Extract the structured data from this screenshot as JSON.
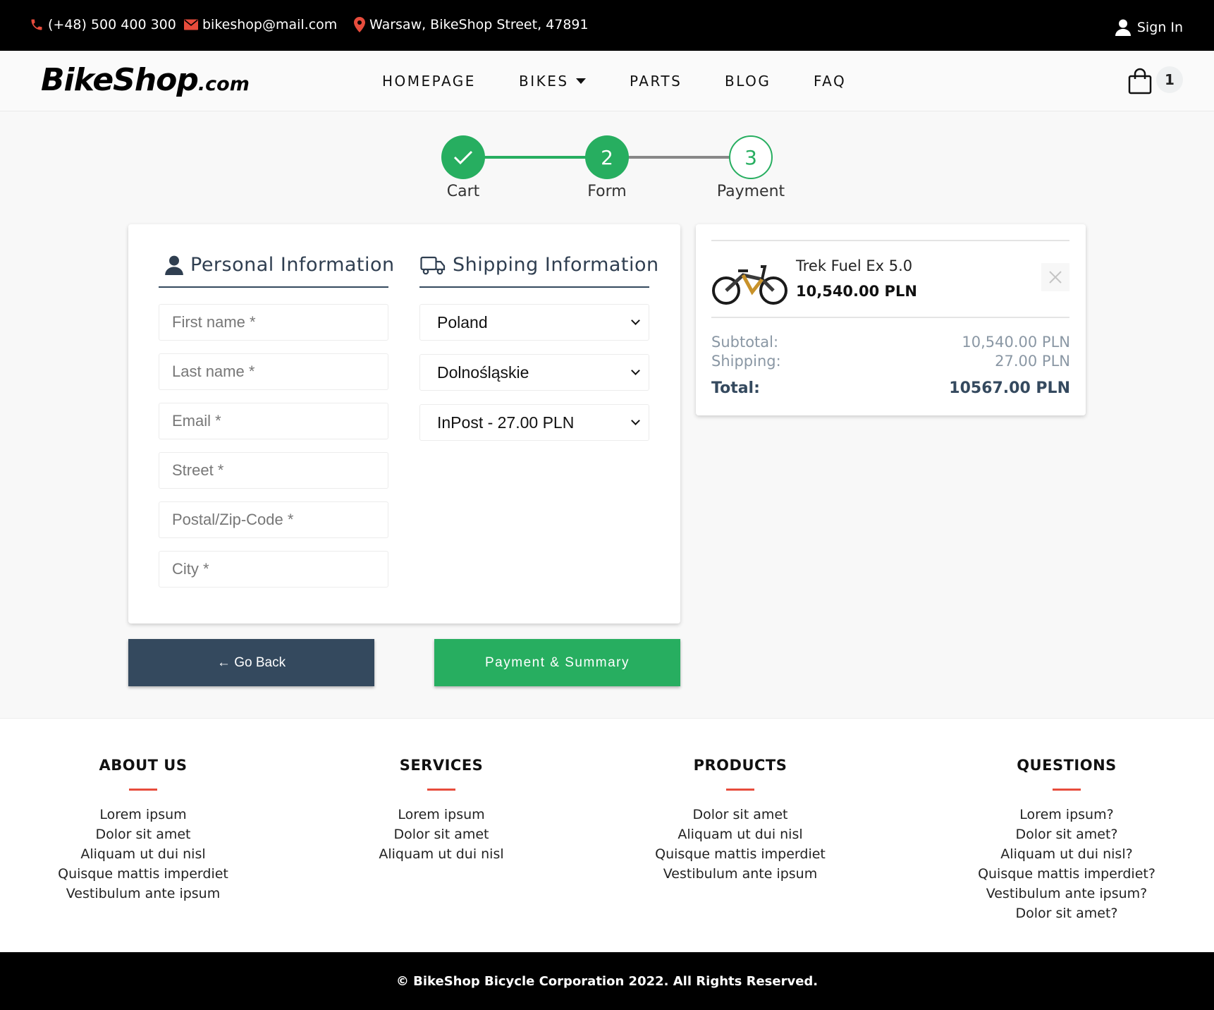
{
  "topbar": {
    "phone": "(+48) 500 400 300",
    "email": "bikeshop@mail.com",
    "address": "Warsaw, BikeShop Street, 47891",
    "sign_in": "Sign In",
    "icon_color": "#e74c3c"
  },
  "navbar": {
    "logo_main": "BikeShop",
    "logo_suffix": ".com",
    "links": [
      "HOMEPAGE",
      "BIKES",
      "PARTS",
      "BLOG",
      "FAQ"
    ],
    "cart_count": "1"
  },
  "stepper": {
    "steps": [
      {
        "label": "Cart",
        "state": "done",
        "number": ""
      },
      {
        "label": "Form",
        "state": "active",
        "number": "2"
      },
      {
        "label": "Payment",
        "state": "pending",
        "number": "3"
      }
    ],
    "accent": "#27ae60"
  },
  "personal": {
    "title": "Personal Information",
    "fields": [
      "First name *",
      "Last name *",
      "Email *",
      "Street *",
      "Postal/Zip-Code *",
      "City *"
    ]
  },
  "shipping": {
    "title": "Shipping Information",
    "country": "Poland",
    "region": "Dolnośląskie",
    "method": "InPost - 27.00 PLN"
  },
  "buttons": {
    "back": "← Go Back",
    "next": "Payment & Summary"
  },
  "summary": {
    "product_name": "Trek Fuel Ex 5.0",
    "product_price": "10,540.00 PLN",
    "subtotal_label": "Subtotal:",
    "subtotal_value": "10,540.00 PLN",
    "shipping_label": "Shipping:",
    "shipping_value": "27.00 PLN",
    "total_label": "Total:",
    "total_value": "10567.00 PLN"
  },
  "footer": {
    "columns": [
      {
        "title": "ABOUT US",
        "items": [
          "Lorem ipsum",
          "Dolor sit amet",
          "Aliquam ut dui nisl",
          "Quisque mattis imperdiet",
          "Vestibulum ante ipsum"
        ]
      },
      {
        "title": "SERVICES",
        "items": [
          "Lorem ipsum",
          "Dolor sit amet",
          "Aliquam ut dui nisl"
        ]
      },
      {
        "title": "PRODUCTS",
        "items": [
          "Dolor sit amet",
          "Aliquam ut dui nisl",
          "Quisque mattis imperdiet",
          "Vestibulum ante ipsum"
        ]
      },
      {
        "title": "QUESTIONS",
        "items": [
          "Lorem ipsum?",
          "Dolor sit amet?",
          "Aliquam ut dui nisl?",
          "Quisque mattis imperdiet?",
          "Vestibulum ante ipsum?",
          "Dolor sit amet?"
        ]
      }
    ],
    "copyright": "© BikeShop Bicycle Corporation 2022. All Rights Reserved."
  }
}
